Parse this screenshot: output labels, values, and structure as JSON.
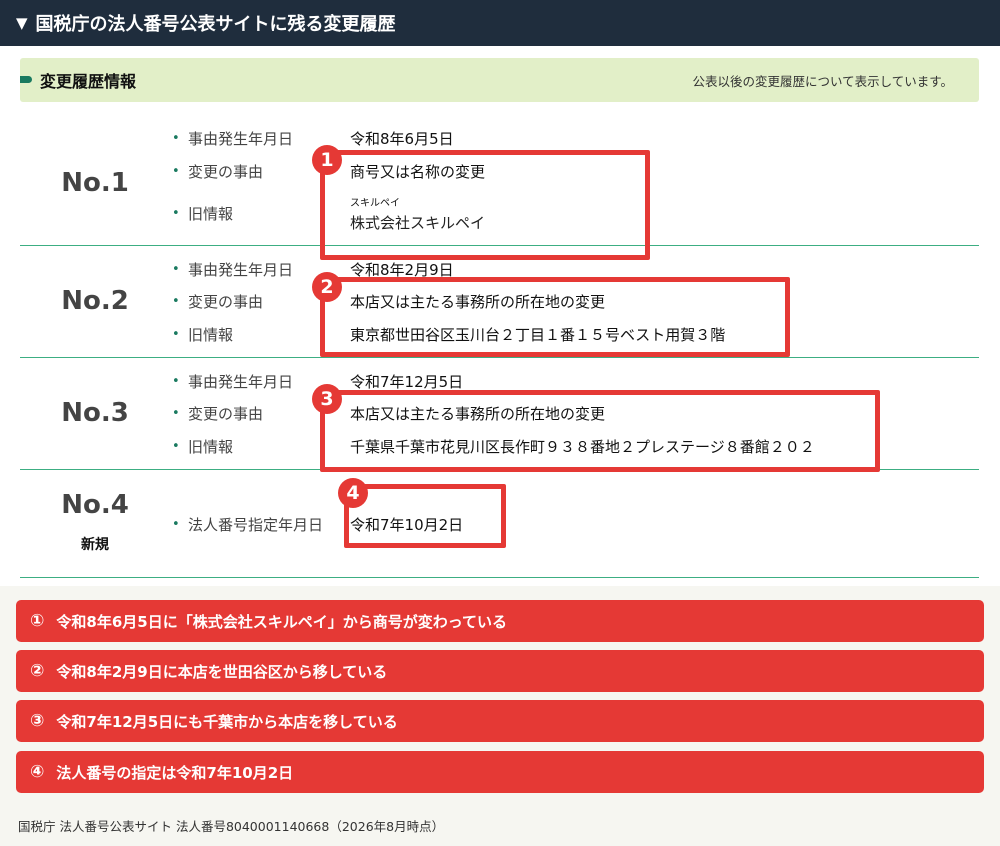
{
  "header": {
    "title": "国税庁の法人番号公表サイトに残る変更履歴"
  },
  "section": {
    "title": "変更履歴情報",
    "note": "公表以後の変更履歴について表示しています。"
  },
  "records": [
    {
      "no": "No.1",
      "rows": [
        {
          "label": "事由発生年月日",
          "value": "令和8年6月5日"
        },
        {
          "label": "変更の事由",
          "value": "商号又は名称の変更"
        },
        {
          "label": "旧情報",
          "kana": "スキルペイ",
          "value": "株式会社スキルペイ"
        }
      ]
    },
    {
      "no": "No.2",
      "rows": [
        {
          "label": "事由発生年月日",
          "value": "令和8年2月9日"
        },
        {
          "label": "変更の事由",
          "value": "本店又は主たる事務所の所在地の変更"
        },
        {
          "label": "旧情報",
          "value": "東京都世田谷区玉川台２丁目１番１５号ベスト用賀３階"
        }
      ]
    },
    {
      "no": "No.3",
      "rows": [
        {
          "label": "事由発生年月日",
          "value": "令和7年12月5日"
        },
        {
          "label": "変更の事由",
          "value": "本店又は主たる事務所の所在地の変更"
        },
        {
          "label": "旧情報",
          "value": "千葉県千葉市花見川区長作町９３８番地２プレステージ８番館２０２"
        }
      ]
    },
    {
      "no": "No.4",
      "sub": "新規",
      "rows": [
        {
          "label": "法人番号指定年月日",
          "value": "令和7年10月2日"
        }
      ]
    }
  ],
  "badges": [
    "1",
    "2",
    "3",
    "4"
  ],
  "annotations": [
    {
      "num": "①",
      "text": "令和8年6月5日に「株式会社スキルペイ」から商号が変わっている"
    },
    {
      "num": "②",
      "text": "令和8年2月9日に本店を世田谷区から移している"
    },
    {
      "num": "③",
      "text": "令和7年12月5日にも千葉市から本店を移している"
    },
    {
      "num": "④",
      "text": "法人番号の指定は令和7年10月2日"
    }
  ],
  "footer": "国税庁 法人番号公表サイト 法人番号8040001140668（2026年8月時点）",
  "bullet": "•",
  "header_icon": "▼",
  "colors": {
    "header_bg": "#1f2d3d",
    "accent_red": "#e53935",
    "section_bg": "#e2efc8",
    "divider_green": "#3cae82"
  }
}
